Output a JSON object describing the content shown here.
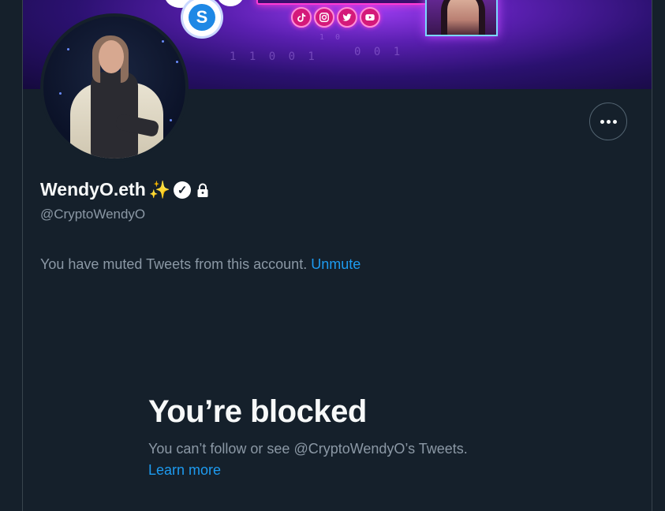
{
  "profile": {
    "display_name": "WendyO.eth",
    "name_emoji": "✨",
    "verified_glyph": "✓",
    "handle": "@CryptoWendyO",
    "more_glyph": "•••"
  },
  "banner": {
    "binary_rows": [
      "1 1 0 0 1",
      "1 0",
      "0 0 1"
    ],
    "coin_letter": "S"
  },
  "muted": {
    "message": "You have muted Tweets from this account. ",
    "unmute_label": "Unmute"
  },
  "blocked": {
    "title": "You’re blocked",
    "subtitle": "You can’t follow or see @CryptoWendyO’s Tweets.",
    "learn_more_label": "Learn more"
  },
  "colors": {
    "background": "#15202b",
    "link": "#1d9bf0",
    "secondary_text": "#8b98a5",
    "primary_text": "#f7f9f9"
  },
  "icons": [
    "tiktok-icon",
    "instagram-icon",
    "twitter-icon",
    "youtube-icon",
    "verified-icon",
    "lock-icon",
    "more-icon"
  ]
}
